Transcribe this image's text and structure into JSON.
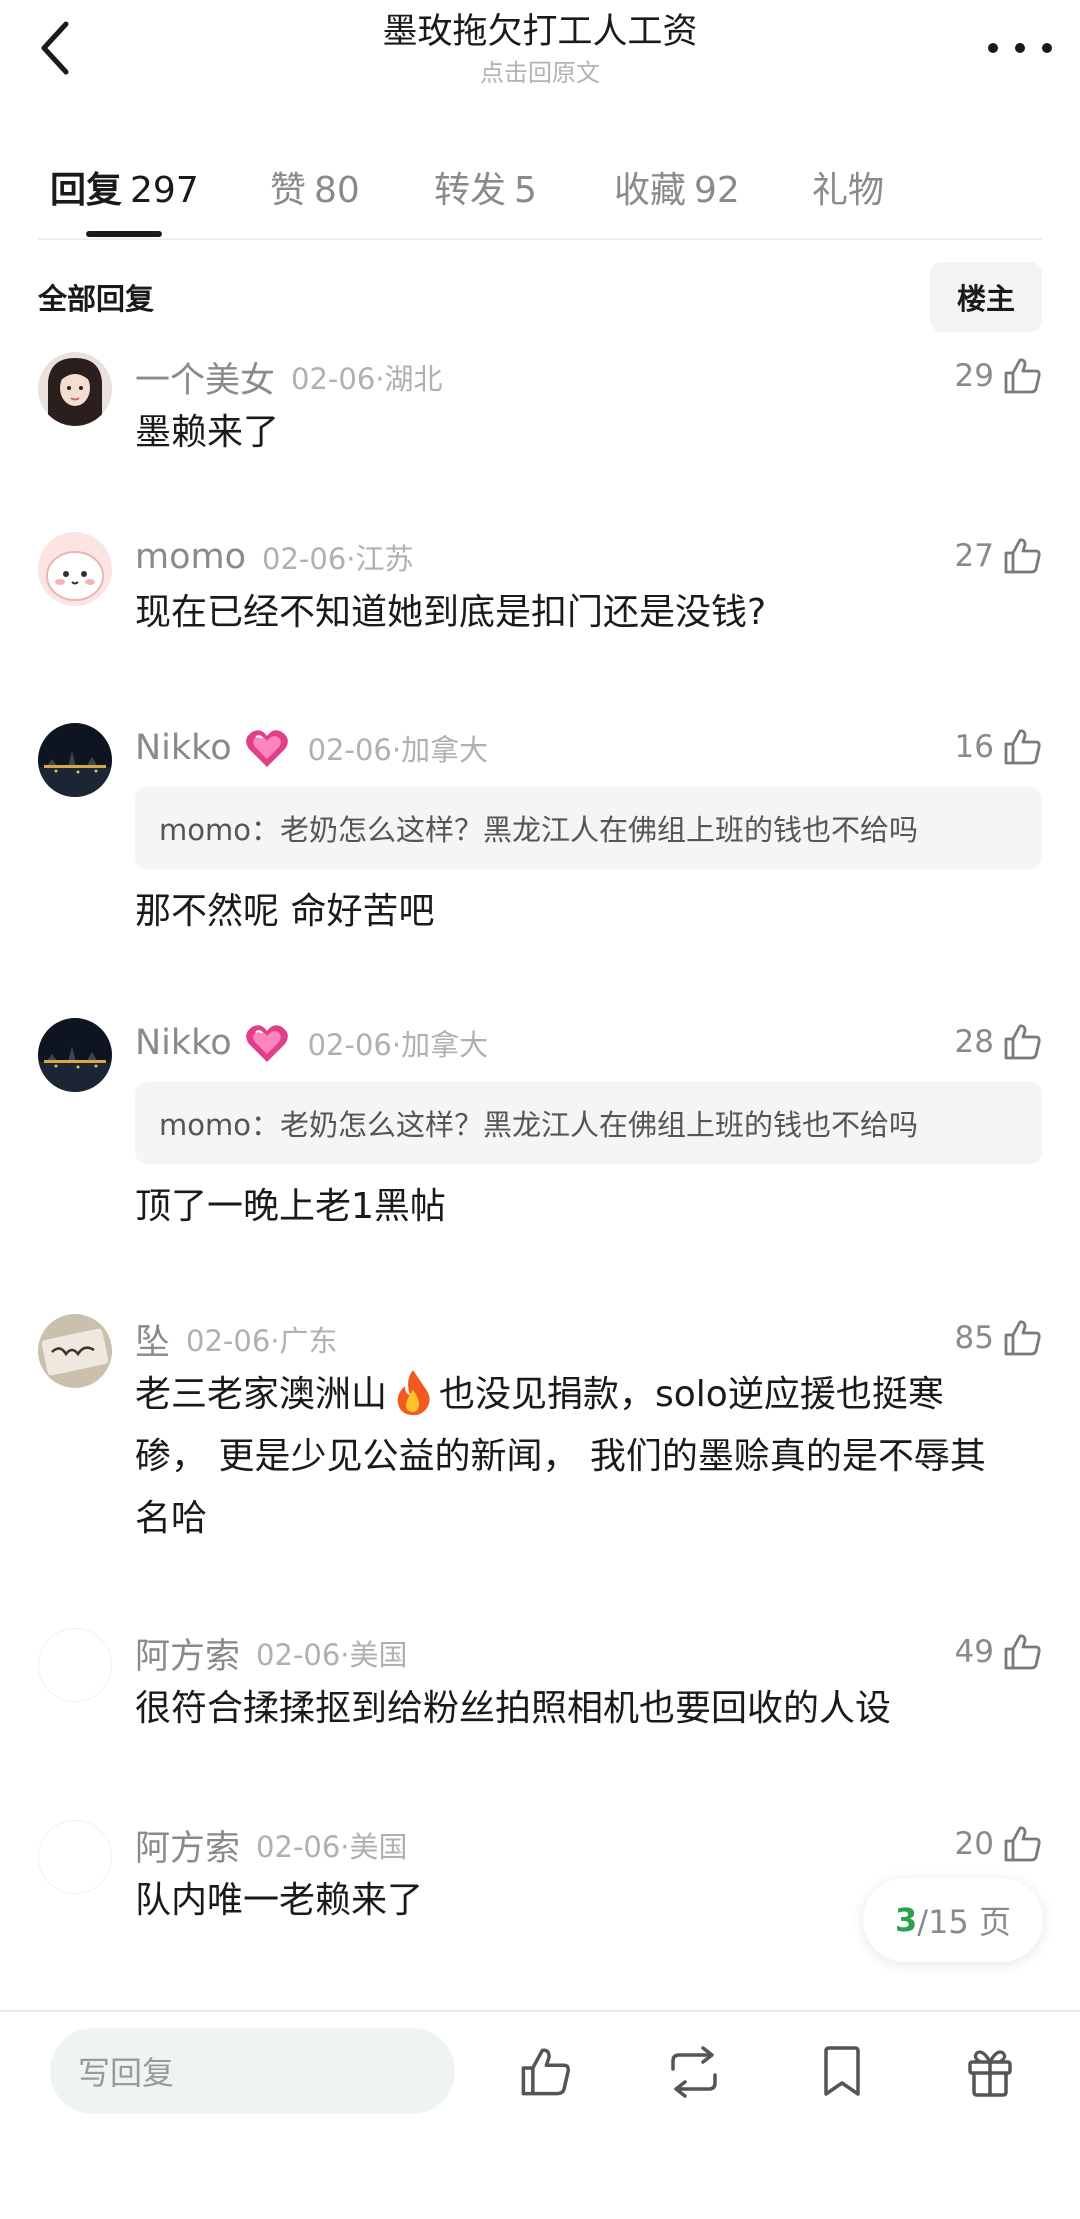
{
  "header": {
    "title": "墨玫拖欠打工人工资",
    "subtitle": "点击回原文"
  },
  "tabs": [
    {
      "label": "回复",
      "count": "297"
    },
    {
      "label": "赞",
      "count": "80"
    },
    {
      "label": "转发",
      "count": "5"
    },
    {
      "label": "收藏",
      "count": "92"
    },
    {
      "label": "礼物",
      "count": ""
    }
  ],
  "filter": {
    "label": "全部回复",
    "op_button": "楼主"
  },
  "comments": [
    {
      "name": "一个美女",
      "date": "02-06",
      "loc": "·湖北",
      "likes": "29",
      "text": "墨赖来了"
    },
    {
      "name": "momo",
      "date": "02-06",
      "loc": "·江苏",
      "likes": "27",
      "text": "现在已经不知道她到底是扣门还是没钱?"
    },
    {
      "name": "Nikko",
      "date": "02-06",
      "loc": "·加拿大",
      "likes": "16",
      "quote": "momo：老奶怎么这样？黑龙江人在佛组上班的钱也不给吗",
      "text": "那不然呢 命好苦吧"
    },
    {
      "name": "Nikko",
      "date": "02-06",
      "loc": "·加拿大",
      "likes": "28",
      "quote": "momo：老奶怎么这样？黑龙江人在佛组上班的钱也不给吗",
      "text": "顶了一晚上老1黑帖"
    },
    {
      "name": "坠",
      "date": "02-06",
      "loc": "·广东",
      "likes": "85",
      "text_l1": "老三老家澳洲山",
      "text_l1b": "也没见捐款，solo逆应援也挺寒",
      "text_l2": "碜， 更是少见公益的新闻， 我们的墨赊真的是不辱其",
      "text_l3": "名哈"
    },
    {
      "name": "阿方索",
      "date": "02-06",
      "loc": "·美国",
      "likes": "49",
      "text": "很符合揉揉抠到给粉丝拍照相机也要回收的人设"
    },
    {
      "name": "阿方索",
      "date": "02-06",
      "loc": "·美国",
      "likes": "20",
      "text": "队内唯一老赖来了"
    }
  ],
  "pager": {
    "current": "3",
    "total": "/15 页"
  },
  "bottom": {
    "reply_placeholder": "写回复"
  },
  "colors": {
    "accent_green": "#2e9e4f",
    "reply_bg": "#eef4ef",
    "heart": "#e0408a"
  }
}
